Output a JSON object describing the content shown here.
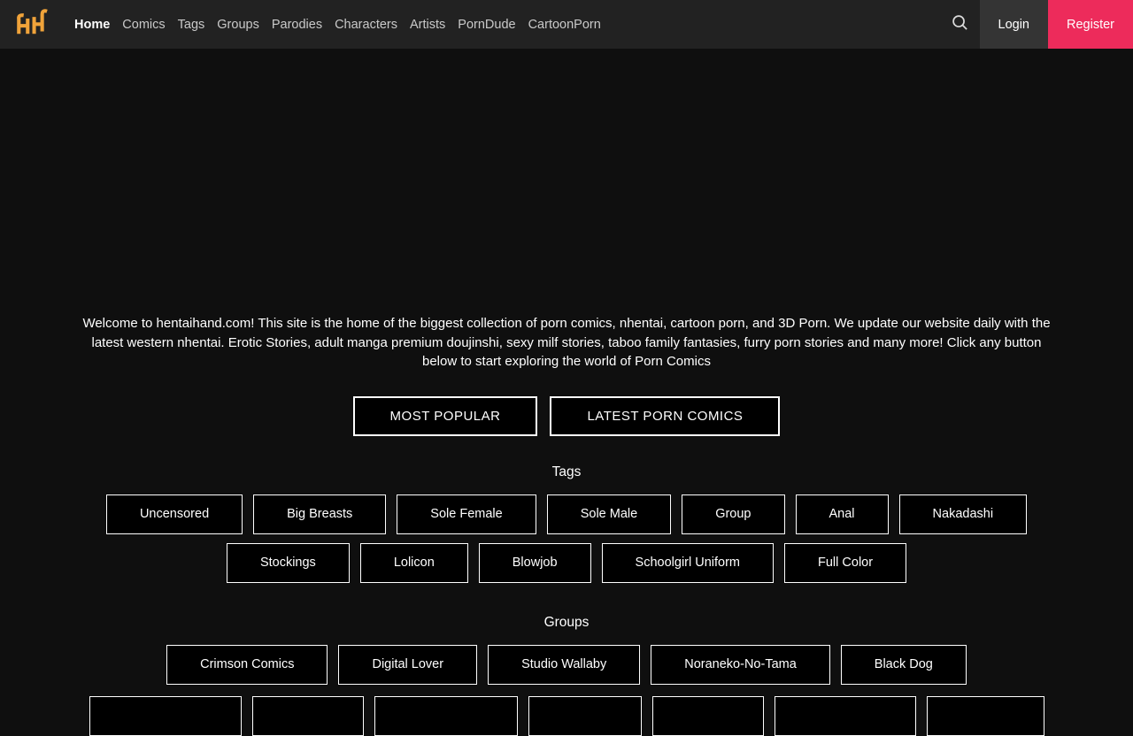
{
  "colors": {
    "page_bg": "#0f0f0f",
    "nav_bg": "#222222",
    "accent_pink": "#ed2b5b",
    "login_gray": "#343434",
    "logo_gold": "#f0a33a",
    "box_border": "#ffffff"
  },
  "nav": {
    "logo_icon": "hh-logo",
    "items": [
      "Home",
      "Comics",
      "Tags",
      "Groups",
      "Parodies",
      "Characters",
      "Artists",
      "PornDude",
      "CartoonPorn"
    ],
    "active_item": "Home",
    "search_icon": "magnifier",
    "login_label": "Login",
    "register_label": "Register"
  },
  "intro": {
    "text": "Welcome to hentaihand.com! This site is the home of the biggest collection of porn comics, nhentai, cartoon porn, and 3D Porn. We update our website daily with the latest western nhentai. Erotic Stories, adult manga premium doujinshi, sexy milf stories, taboo family fantasies, furry porn stories and many more! Click any button below to start exploring the world of Porn Comics"
  },
  "cta": {
    "most_popular": "MOST POPULAR",
    "latest": "LATEST PORN COMICS"
  },
  "tags": {
    "title": "Tags",
    "row1": [
      "Uncensored",
      "Big Breasts",
      "Sole Female",
      "Sole Male",
      "Group",
      "Anal",
      "Nakadashi"
    ],
    "row2": [
      "Stockings",
      "Lolicon",
      "Blowjob",
      "Schoolgirl Uniform",
      "Full Color"
    ]
  },
  "groups": {
    "title": "Groups",
    "row1": [
      "Crimson Comics",
      "Digital Lover",
      "Studio Wallaby",
      "Noraneko-No-Tama",
      "Black Dog"
    ],
    "partial_row": [
      "",
      "",
      "",
      "",
      "",
      "",
      ""
    ]
  }
}
